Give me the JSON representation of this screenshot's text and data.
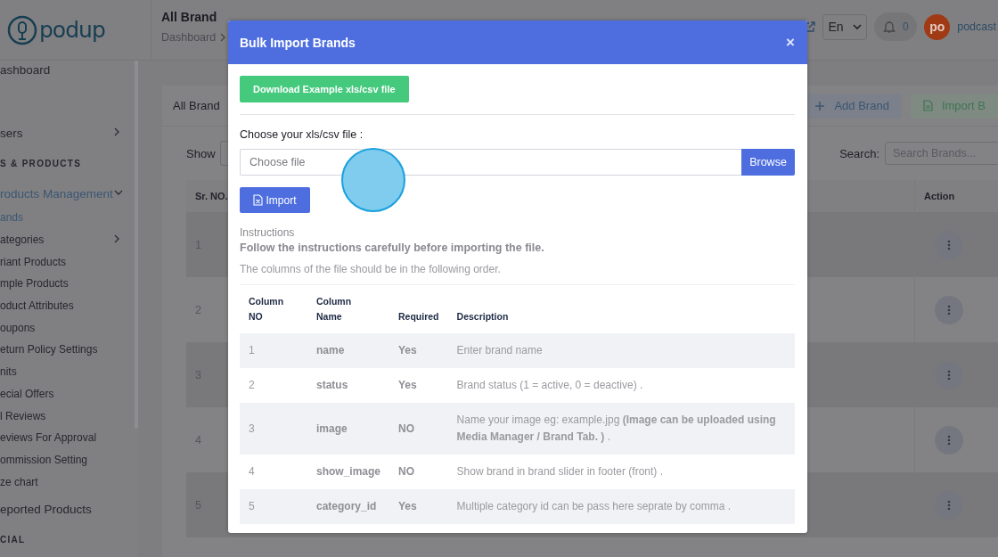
{
  "logo": {
    "text": "podup"
  },
  "sidebar": {
    "items": [
      {
        "label": "ashboard",
        "kind": "item",
        "selected": false
      },
      {
        "label": "sers",
        "kind": "item",
        "selected": false,
        "expanded": false
      },
      {
        "label": "S & PRODUCTS",
        "kind": "heading",
        "selected": false
      },
      {
        "label": "roducts Management",
        "kind": "item",
        "selected": true,
        "expanded": true
      },
      {
        "label": "ands",
        "kind": "subitem",
        "selected": true
      },
      {
        "label": "ategories",
        "kind": "subitem",
        "selected": false,
        "expanded": false
      },
      {
        "label": "riant Products",
        "kind": "subitem",
        "selected": false
      },
      {
        "label": "mple Products",
        "kind": "subitem",
        "selected": false
      },
      {
        "label": "oduct Attributes",
        "kind": "subitem",
        "selected": false
      },
      {
        "label": "oupons",
        "kind": "subitem",
        "selected": false
      },
      {
        "label": "eturn Policy Settings",
        "kind": "subitem",
        "selected": false
      },
      {
        "label": "nits",
        "kind": "subitem",
        "selected": false
      },
      {
        "label": "ecial Offers",
        "kind": "subitem",
        "selected": false
      },
      {
        "label": "l Reviews",
        "kind": "subitem",
        "selected": false
      },
      {
        "label": "eviews For Approval",
        "kind": "subitem",
        "selected": false
      },
      {
        "label": "ommission Setting",
        "kind": "subitem",
        "selected": false
      },
      {
        "label": "ze chart",
        "kind": "subitem",
        "selected": false
      },
      {
        "label": "eported Products",
        "kind": "item",
        "selected": false
      },
      {
        "label": "CIAL",
        "kind": "heading",
        "selected": false
      }
    ]
  },
  "header": {
    "title": "All Brand",
    "breadcrumb": "Dashboard",
    "language": "En",
    "notifications": "0",
    "avatar": "po",
    "user": "podcast"
  },
  "card": {
    "title": "All Brand",
    "buttons": [
      {
        "label": "Add Brand",
        "kind": "add"
      },
      {
        "label": "Import B",
        "kind": "import"
      }
    ],
    "show_label": "Show",
    "search_label": "Search:",
    "search": {
      "placeholder": "Search Brands..."
    },
    "table": {
      "columns": [
        "Sr. NO.",
        "Action"
      ],
      "rows": [
        "1",
        "2",
        "3",
        "4",
        "5"
      ]
    }
  },
  "modal": {
    "title": "Bulk Import Brands",
    "close": "×",
    "download_button": "Download Example xls/csv file",
    "file_label": "Choose your xls/csv file :",
    "file_field": {
      "placeholder": "Choose file"
    },
    "browse_button": "Browse",
    "import_button": "Import",
    "instructions_heading": "Instructions",
    "instructions_note": "Follow the instructions carefully before importing the file.",
    "order_note": "The columns of the file should be in the following order.",
    "columns": [
      {
        "lines": [
          "Column",
          "NO"
        ]
      },
      {
        "lines": [
          "Column",
          "Name"
        ]
      },
      {
        "lines": [
          "Required"
        ]
      },
      {
        "lines": [
          "Description"
        ]
      }
    ],
    "rows": [
      {
        "no": "1",
        "name": "name",
        "required": "Yes",
        "description": "Enter brand name"
      },
      {
        "no": "2",
        "name": "status",
        "required": "Yes",
        "description": "Brand status (1 = active, 0 = deactive) ."
      },
      {
        "no": "3",
        "name": "image",
        "required": "NO",
        "description": "Name your image eg: example.jpg **(Image can be uploaded using Media Manager / Brand Tab. )** ."
      },
      {
        "no": "4",
        "name": "show_image",
        "required": "NO",
        "description": "Show brand in brand slider in footer (front) ."
      },
      {
        "no": "5",
        "name": "category_id",
        "required": "Yes",
        "description": "Multiple category id can be pass here seprate by comma ."
      }
    ]
  }
}
